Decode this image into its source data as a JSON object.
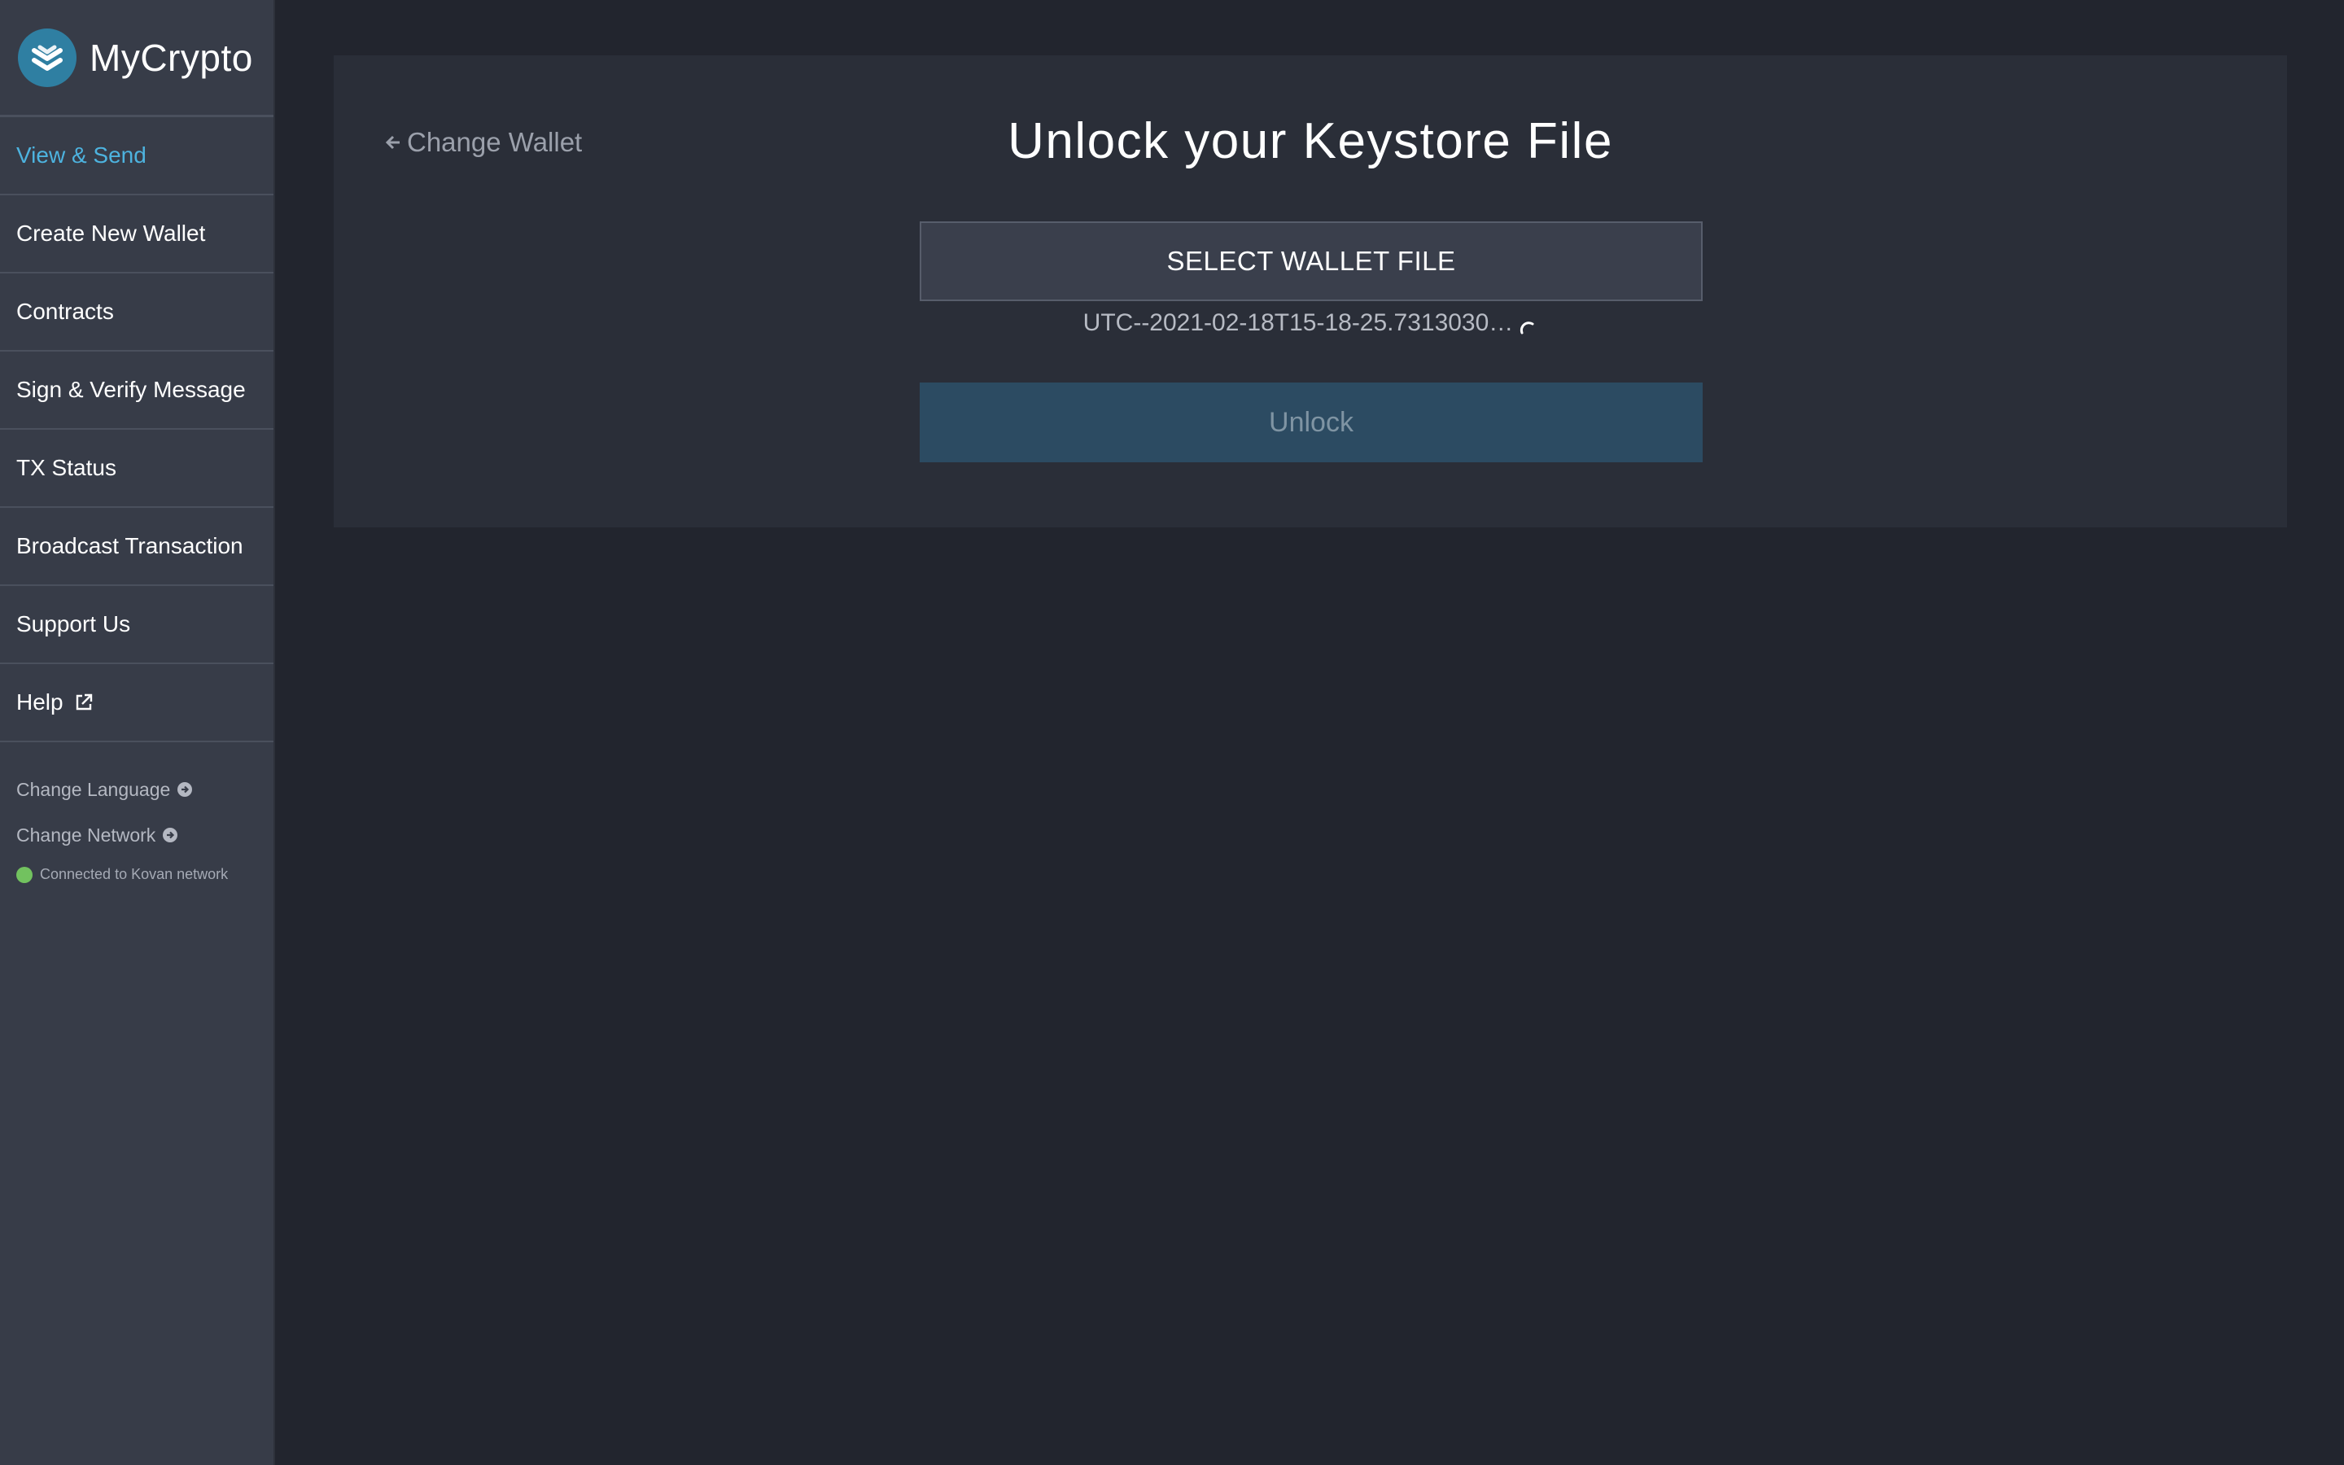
{
  "brand": {
    "name": "MyCrypto",
    "logo_color": "#2f7fa2"
  },
  "sidebar": {
    "items": [
      {
        "label": "View & Send",
        "active": true
      },
      {
        "label": "Create New Wallet"
      },
      {
        "label": "Contracts"
      },
      {
        "label": "Sign & Verify Message"
      },
      {
        "label": "TX Status"
      },
      {
        "label": "Broadcast Transaction"
      },
      {
        "label": "Support Us"
      },
      {
        "label": "Help",
        "icon": "external-link-icon"
      }
    ],
    "change_language": "Change Language",
    "change_network": "Change Network",
    "network_status": "Connected to Kovan network",
    "status_color": "#72c25f",
    "active_color": "#4db3df"
  },
  "main": {
    "back_label": "Change Wallet",
    "title": "Unlock your Keystore File",
    "select_file_label": "SELECT WALLET FILE",
    "file_name": "UTC--2021-02-18T15-18-25.7313030…",
    "unlock_label": "Unlock"
  }
}
